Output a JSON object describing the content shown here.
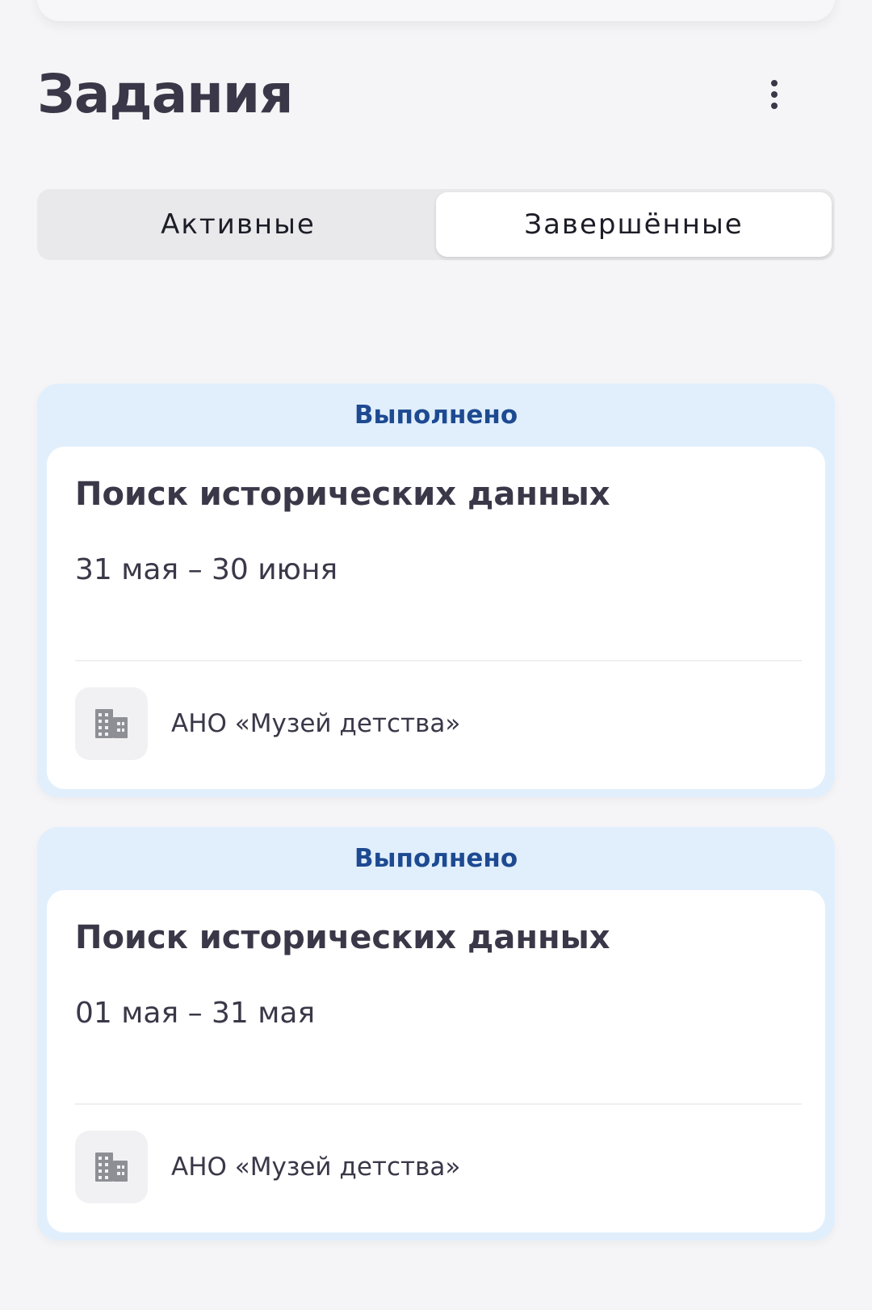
{
  "header": {
    "title": "Задания",
    "more_icon": "more-vertical-icon"
  },
  "tabs": [
    {
      "label": "Активные",
      "selected": false
    },
    {
      "label": "Завершённые",
      "selected": true
    }
  ],
  "tasks": [
    {
      "status": "Выполнено",
      "title": "Поиск исторических данных",
      "dates": "31 мая – 30 июня",
      "org_icon": "building-icon",
      "organization": "АНО «Музей детства»"
    },
    {
      "status": "Выполнено",
      "title": "Поиск исторических данных",
      "dates": "01 мая – 31 мая",
      "org_icon": "building-icon",
      "organization": "АНО «Музей детства»"
    }
  ],
  "colors": {
    "background": "#f5f5f7",
    "status_band": "#e1effd",
    "status_text": "#1d4a91",
    "text_primary": "#3a3848",
    "segment_track": "#e9e9ec"
  }
}
